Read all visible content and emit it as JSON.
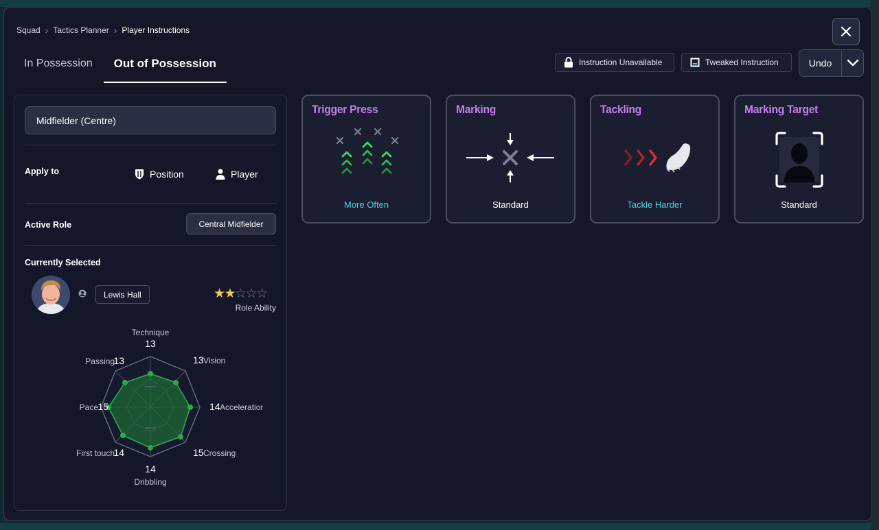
{
  "breadcrumb": [
    "Squad",
    "Tactics Planner",
    "Player Instructions"
  ],
  "tabs": [
    {
      "label": "In Possession",
      "active": false
    },
    {
      "label": "Out of Possession",
      "active": true
    }
  ],
  "legend": {
    "unavailable": "Instruction Unavailable",
    "tweaked": "Tweaked Instruction"
  },
  "undo_label": "Undo",
  "left_panel": {
    "position": "Midfielder (Centre)",
    "apply_to_label": "Apply to",
    "apply_options": [
      "Position",
      "Player"
    ],
    "active_role_label": "Active Role",
    "active_role": "Central Midfielder",
    "currently_selected_label": "Currently Selected",
    "player_name": "Lewis Hall",
    "role_ability_label": "Role Ability",
    "role_ability_stars": 2,
    "role_ability_max": 5
  },
  "attributes": [
    {
      "name": "Technique",
      "value": "13"
    },
    {
      "name": "Vision",
      "value": "13"
    },
    {
      "name": "Acceleration",
      "value": "14"
    },
    {
      "name": "Crossing",
      "value": "15"
    },
    {
      "name": "Dribbling",
      "value": "14"
    },
    {
      "name": "First touch",
      "value": "14"
    },
    {
      "name": "Pace",
      "value": "15"
    },
    {
      "name": "Passing",
      "value": "13"
    }
  ],
  "instructions": [
    {
      "title": "Trigger Press",
      "value": "More Often",
      "modified": true
    },
    {
      "title": "Marking",
      "value": "Standard",
      "modified": false
    },
    {
      "title": "Tackling",
      "value": "Tackle Harder",
      "modified": true
    },
    {
      "title": "Marking Target",
      "value": "Standard",
      "modified": false
    }
  ],
  "colors": {
    "accent_title": "#c77ef0",
    "modified_value": "#52d1dc",
    "radar_fill": "#1f6b35",
    "radar_point": "#2ea84a",
    "star": "#f2c94c"
  }
}
